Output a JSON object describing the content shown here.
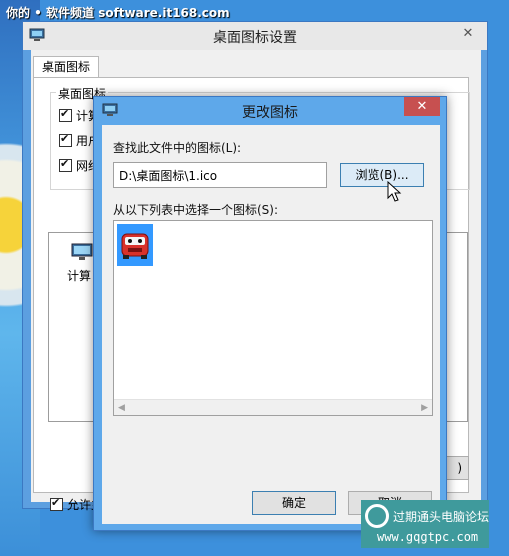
{
  "watermark_top": "你的 • 软件频道 software.it168.com",
  "main_window": {
    "title": "桌面图标设置",
    "close_glyph": "✕",
    "tab_label": "桌面图标",
    "group_label": "桌面图标",
    "checkbox_items": [
      "计算",
      "用户",
      "网络"
    ],
    "icon_label": "计算",
    "allow_checkbox_label": "允许主",
    "under_button_label": ")"
  },
  "dialog": {
    "title": "更改图标",
    "close_glyph": "✕",
    "find_label": "查找此文件中的图标(L):",
    "path_value": "D:\\桌面图标\\1.ico",
    "browse_label": "浏览(B)...",
    "select_label": "从以下列表中选择一个图标(S):",
    "ok_label": "确定",
    "cancel_label": "取消"
  },
  "watermark_bottom": {
    "line1": "过期通头电脑论坛",
    "line2": "www.gqgtpc.com"
  },
  "colors": {
    "desktop_blue": "#3d90dc",
    "dialog_frame": "#5ea8ea",
    "close_red": "#c75050",
    "selection_blue": "#3399ff"
  }
}
